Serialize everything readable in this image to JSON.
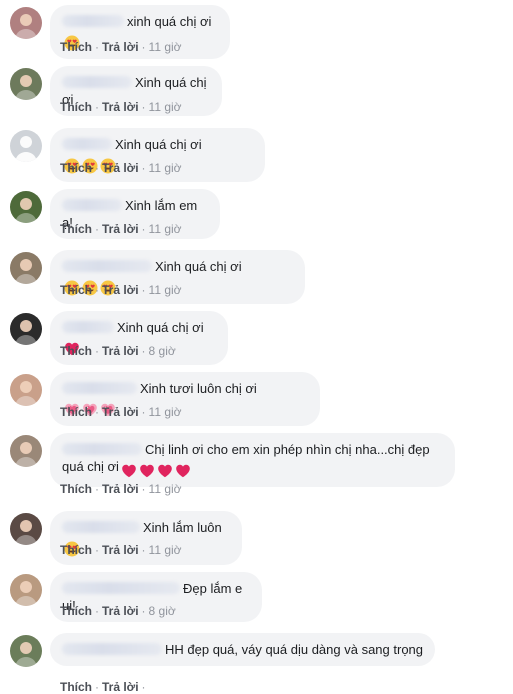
{
  "labels": {
    "like": "Thích",
    "reply": "Trả lời",
    "separator": "·"
  },
  "comments": [
    {
      "text": "xinh quá chị ơi",
      "emojis": [
        "heart-eyes"
      ],
      "time": "11 giờ",
      "avatar": "#b08080"
    },
    {
      "text": "Xinh quá chị ơi",
      "emojis": [],
      "time": "11 giờ",
      "avatar": "#6d7a5c"
    },
    {
      "text": "Xinh quá chị ơi",
      "emojis": [
        "heart-eyes",
        "heart-eyes",
        "heart-eyes"
      ],
      "time": "11 giờ",
      "avatar": "#cfd3d8"
    },
    {
      "text": "Xinh lắm em ạ!",
      "emojis": [],
      "time": "11 giờ",
      "avatar": "#4e6a3a"
    },
    {
      "text": "Xinh quá chị ơi",
      "emojis": [
        "heart-eyes",
        "heart-eyes",
        "heart-eyes"
      ],
      "time": "11 giờ",
      "avatar": "#8a7a66"
    },
    {
      "text": "Xinh quá chị ơi",
      "emojis": [
        "heart"
      ],
      "time": "8 giờ",
      "avatar": "#2b2b2b"
    },
    {
      "text": "Xinh tươi luôn chị ơi",
      "emojis": [
        "sparkle-heart",
        "sparkle-heart",
        "sparkle-heart"
      ],
      "time": "11 giờ",
      "avatar": "#c9a08a"
    },
    {
      "text": "Chị linh ơi cho em xin phép nhìn chị nha...chị đẹp quá chị ơi",
      "emojis": [
        "heart",
        "heart",
        "heart",
        "heart"
      ],
      "time": "11 giờ",
      "avatar": "#9a8878"
    },
    {
      "text": "Xinh lắm luôn",
      "emojis": [
        "heart-eyes"
      ],
      "time": "11 giờ",
      "avatar": "#5a4a44"
    },
    {
      "text": "Đẹp lắm e ui!",
      "emojis": [],
      "time": "8 giờ",
      "avatar": "#b99a80"
    },
    {
      "text": "HH đẹp quá, váy quá dịu dàng và sang trọng",
      "emojis": [],
      "time": "",
      "avatar": "#6b7d5a"
    }
  ]
}
